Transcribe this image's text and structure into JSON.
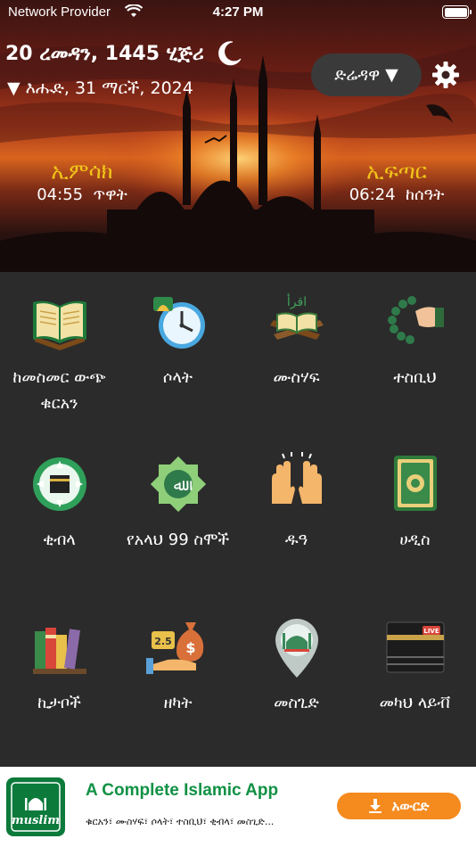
{
  "status_bar": {
    "carrier": "Network Provider",
    "time": "4:27 PM"
  },
  "header": {
    "hijri_date": "20 ረመዳን, 1445 ሂጅሪ",
    "gregorian_date": "▼ እሑድ, 31 ማርች, 2024",
    "city": "ድሬዳዋ",
    "city_caret": "▼",
    "imsak": {
      "name": "ኢምሳክ",
      "time": "04:55",
      "period": "ጥዋት"
    },
    "iftar": {
      "name": "ኢፍጣር",
      "time": "06:24",
      "period": "ከሰዓት"
    }
  },
  "menu": [
    {
      "label": "ከመስመር ውጭ ቁርአን",
      "icon": "quran-book-icon"
    },
    {
      "label": "ሶላት",
      "icon": "prayer-clock-icon"
    },
    {
      "label": "ሙስሃፍ",
      "icon": "mushaf-icon"
    },
    {
      "label": "ተስቢህ",
      "icon": "tasbih-icon"
    },
    {
      "label": "ቂብላ",
      "icon": "qibla-compass-icon"
    },
    {
      "label": "የአላህ 99 ስሞች",
      "icon": "allah-names-icon"
    },
    {
      "label": "ዱዓ",
      "icon": "dua-hands-icon"
    },
    {
      "label": "ሀዲስ",
      "icon": "hadith-book-icon"
    },
    {
      "label": "ኪታቦች",
      "icon": "books-icon"
    },
    {
      "label": "ዘካት",
      "icon": "zakat-money-icon"
    },
    {
      "label": "መስጊድ",
      "icon": "mosque-pin-icon"
    },
    {
      "label": "መካህ ላይቭ",
      "icon": "kaaba-live-icon"
    }
  ],
  "ad": {
    "logo_text": "muslim",
    "title": "A Complete Islamic App",
    "subtitle": "ቁርአን፣ ሙስሃፍ፣ ሶላት፣ ተስቢህ፣ ቂብላ፣ መስጊድ...",
    "cta": "አውርድ"
  },
  "colors": {
    "accent_gold": "#f0c419",
    "grid_bg": "#2b2b2b",
    "ad_green": "#109144",
    "cta_orange": "#f58a1f"
  }
}
